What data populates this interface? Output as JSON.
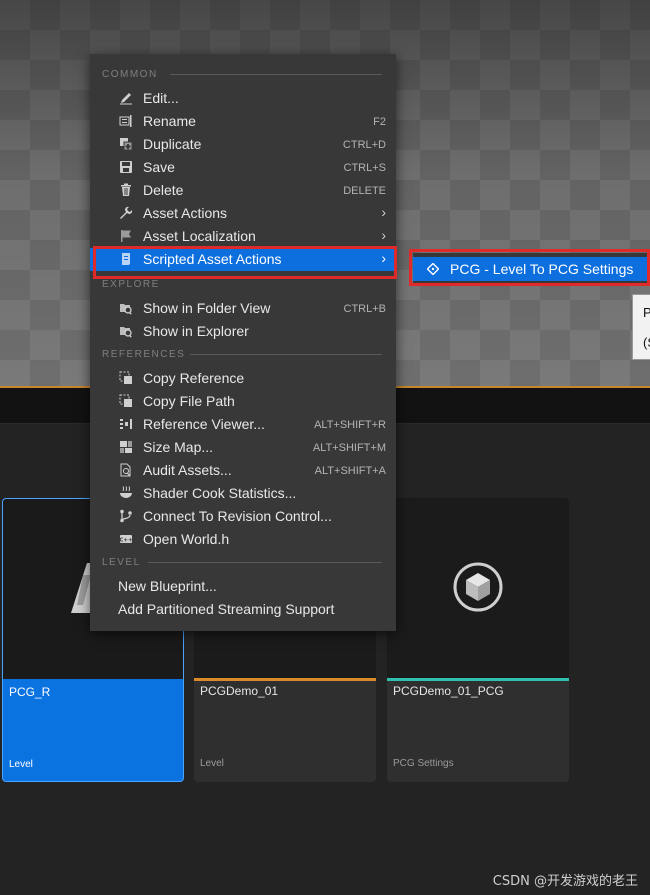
{
  "context_menu": {
    "sections": [
      {
        "header": "COMMON"
      },
      {
        "header": "EXPLORE"
      },
      {
        "header": "REFERENCES"
      },
      {
        "header": "LEVEL"
      }
    ],
    "common": [
      {
        "label": "Edit...",
        "shortcut": "",
        "icon": "pencil-icon"
      },
      {
        "label": "Rename",
        "shortcut": "F2",
        "icon": "rename-icon"
      },
      {
        "label": "Duplicate",
        "shortcut": "CTRL+D",
        "icon": "duplicate-icon"
      },
      {
        "label": "Save",
        "shortcut": "CTRL+S",
        "icon": "save-icon"
      },
      {
        "label": "Delete",
        "shortcut": "DELETE",
        "icon": "trash-icon"
      },
      {
        "label": "Asset Actions",
        "icon": "wrench-icon"
      },
      {
        "label": "Asset Localization",
        "icon": "flag-icon"
      },
      {
        "label": "Scripted Asset Actions",
        "icon": "script-icon"
      }
    ],
    "explore": [
      {
        "label": "Show in Folder View",
        "shortcut": "CTRL+B",
        "icon": "folder-search-icon"
      },
      {
        "label": "Show in Explorer",
        "shortcut": "",
        "icon": "folder-search-icon"
      }
    ],
    "references": [
      {
        "label": "Copy Reference",
        "shortcut": "",
        "icon": "copy-reference-icon"
      },
      {
        "label": "Copy File Path",
        "shortcut": "",
        "icon": "copy-path-icon"
      },
      {
        "label": "Reference Viewer...",
        "shortcut": "ALT+SHIFT+R",
        "icon": "reference-viewer-icon"
      },
      {
        "label": "Size Map...",
        "shortcut": "ALT+SHIFT+M",
        "icon": "size-map-icon"
      },
      {
        "label": "Audit Assets...",
        "shortcut": "ALT+SHIFT+A",
        "icon": "audit-icon"
      },
      {
        "label": "Shader Cook Statistics...",
        "shortcut": "",
        "icon": "shader-icon"
      },
      {
        "label": "Connect To Revision Control...",
        "shortcut": "",
        "icon": "revision-control-icon"
      },
      {
        "label": "Open World.h",
        "shortcut": "",
        "icon": "cpp-file-icon"
      }
    ],
    "level": [
      {
        "label": "New Blueprint..."
      },
      {
        "label": "Add Partitioned Streaming Support"
      }
    ]
  },
  "submenu": {
    "item_label": "PCG - Level To PCG Settings",
    "icon": "diamond-icon"
  },
  "tooltip": {
    "line1": "P",
    "line2": "(S"
  },
  "assets": [
    {
      "name": "PCG_R",
      "type": "Level",
      "selected": true
    },
    {
      "name": "PCGDemo_01",
      "type": "Level",
      "accent": "#d98a2b"
    },
    {
      "name": "PCGDemo_01_PCG",
      "type": "PCG Settings",
      "accent": "#2fc0b0"
    }
  ],
  "watermark": "CSDN @开发游戏的老王",
  "colors": {
    "highlight": "#0d6fde",
    "annotation": "#e02a2a",
    "menu_bg": "#383838"
  }
}
